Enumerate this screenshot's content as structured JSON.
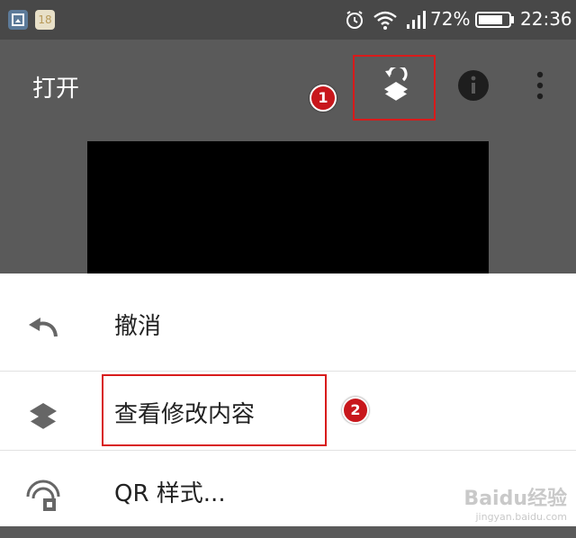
{
  "status_bar": {
    "battery_percent": "72%",
    "time": "22:36",
    "badge_number": "18"
  },
  "app_bar": {
    "title": "打开"
  },
  "menu": {
    "items": [
      {
        "label": "撤消",
        "icon": "undo-icon"
      },
      {
        "label": "查看修改内容",
        "icon": "layers-icon"
      },
      {
        "label": "QR 样式...",
        "icon": "qr-style-icon"
      }
    ]
  },
  "annotations": {
    "step1": "1",
    "step2": "2"
  },
  "watermark": {
    "brand": "Baidu经验",
    "url": "jingyan.baidu.com"
  },
  "colors": {
    "callout": "#d81b1b",
    "badge": "#c8171c"
  }
}
